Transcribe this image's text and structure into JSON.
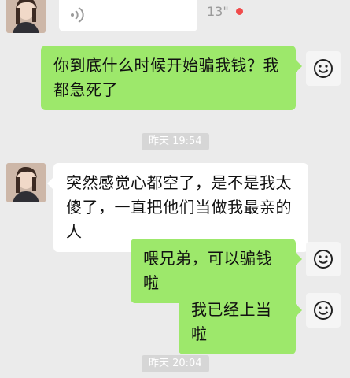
{
  "conversation": {
    "voice_message": {
      "duration": "13\"",
      "icon": "voice-wave-icon",
      "unread_color": "#f04b4b"
    },
    "messages": [
      {
        "side": "right",
        "text": "你到底什么时候开始骗我钱？我都急死了"
      },
      {
        "side": "left",
        "text": "突然感觉心都空了，是不是我太傻了，一直把他们当做我最亲的人"
      },
      {
        "side": "right",
        "text": "喂兄弟，可以骗钱啦"
      },
      {
        "side": "right",
        "text": "我已经上当啦"
      }
    ],
    "timestamps": [
      "昨天 19:54",
      "昨天 20:04"
    ],
    "right_avatar_icon": "smiley-face-icon",
    "colors": {
      "background": "#ebebeb",
      "sent_bubble": "#9de86b",
      "received_bubble": "#ffffff"
    }
  }
}
